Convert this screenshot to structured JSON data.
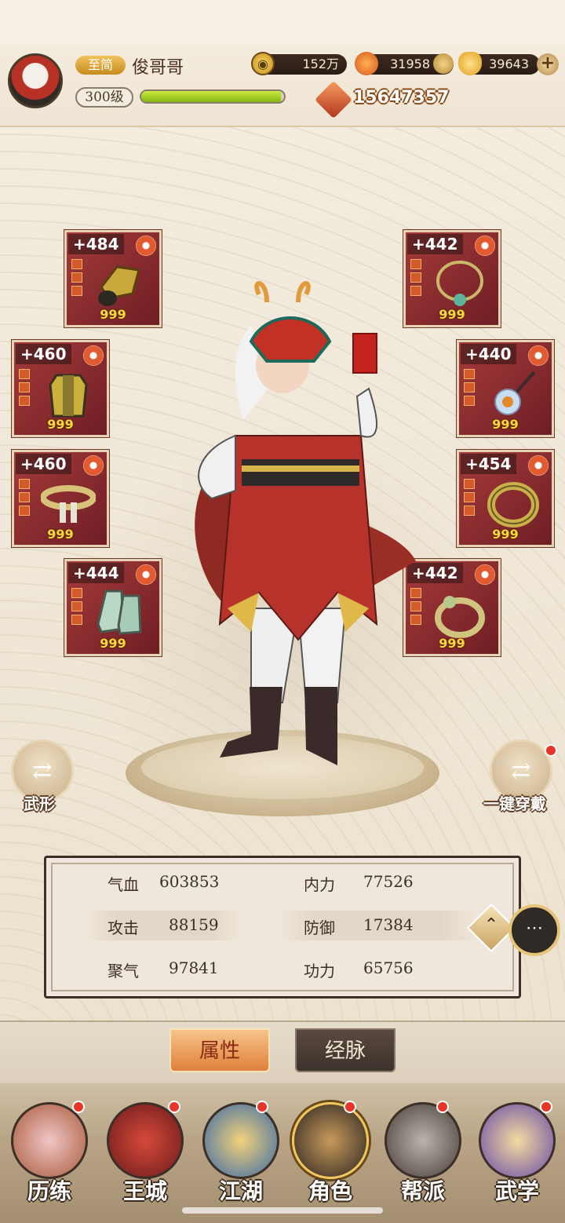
{
  "header": {
    "vip_label": "至简",
    "player_name": "俊哥哥",
    "level_label": "300级",
    "exp_progress": 0.98,
    "coins": "152万",
    "gems": "31958",
    "ingots": "39643",
    "power": "15647357"
  },
  "equipment": {
    "left": [
      {
        "level": "+484",
        "count": "999",
        "icon": "gauntlet-icon"
      },
      {
        "level": "+460",
        "count": "999",
        "icon": "armor-icon"
      },
      {
        "level": "+460",
        "count": "999",
        "icon": "belt-icon"
      },
      {
        "level": "+444",
        "count": "999",
        "icon": "boots-icon"
      }
    ],
    "right": [
      {
        "level": "+442",
        "count": "999",
        "icon": "necklace-icon"
      },
      {
        "level": "+440",
        "count": "999",
        "icon": "hairpin-icon"
      },
      {
        "level": "+454",
        "count": "999",
        "icon": "bracelet-icon"
      },
      {
        "level": "+442",
        "count": "999",
        "icon": "ring-icon"
      }
    ]
  },
  "actions": {
    "appearance_label": "武形",
    "equip_all_label": "一键穿戴"
  },
  "stats": {
    "hp_label": "气血",
    "hp_value": "603853",
    "inner_label": "内力",
    "inner_value": "77526",
    "attack_label": "攻击",
    "attack_value": "88159",
    "defense_label": "防御",
    "defense_value": "17384",
    "focus_label": "聚气",
    "focus_value": "97841",
    "skill_label": "功力",
    "skill_value": "65756"
  },
  "tabs": {
    "attributes": "属性",
    "meridians": "经脉"
  },
  "nav": [
    {
      "label": "历练"
    },
    {
      "label": "王城"
    },
    {
      "label": "江湖"
    },
    {
      "label": "角色"
    },
    {
      "label": "帮派"
    },
    {
      "label": "武学"
    }
  ],
  "colors": {
    "accent_red": "#a53a3a",
    "gold": "#f7d940",
    "exp_green": "#9fd11f",
    "badge_red": "#e8352a"
  }
}
